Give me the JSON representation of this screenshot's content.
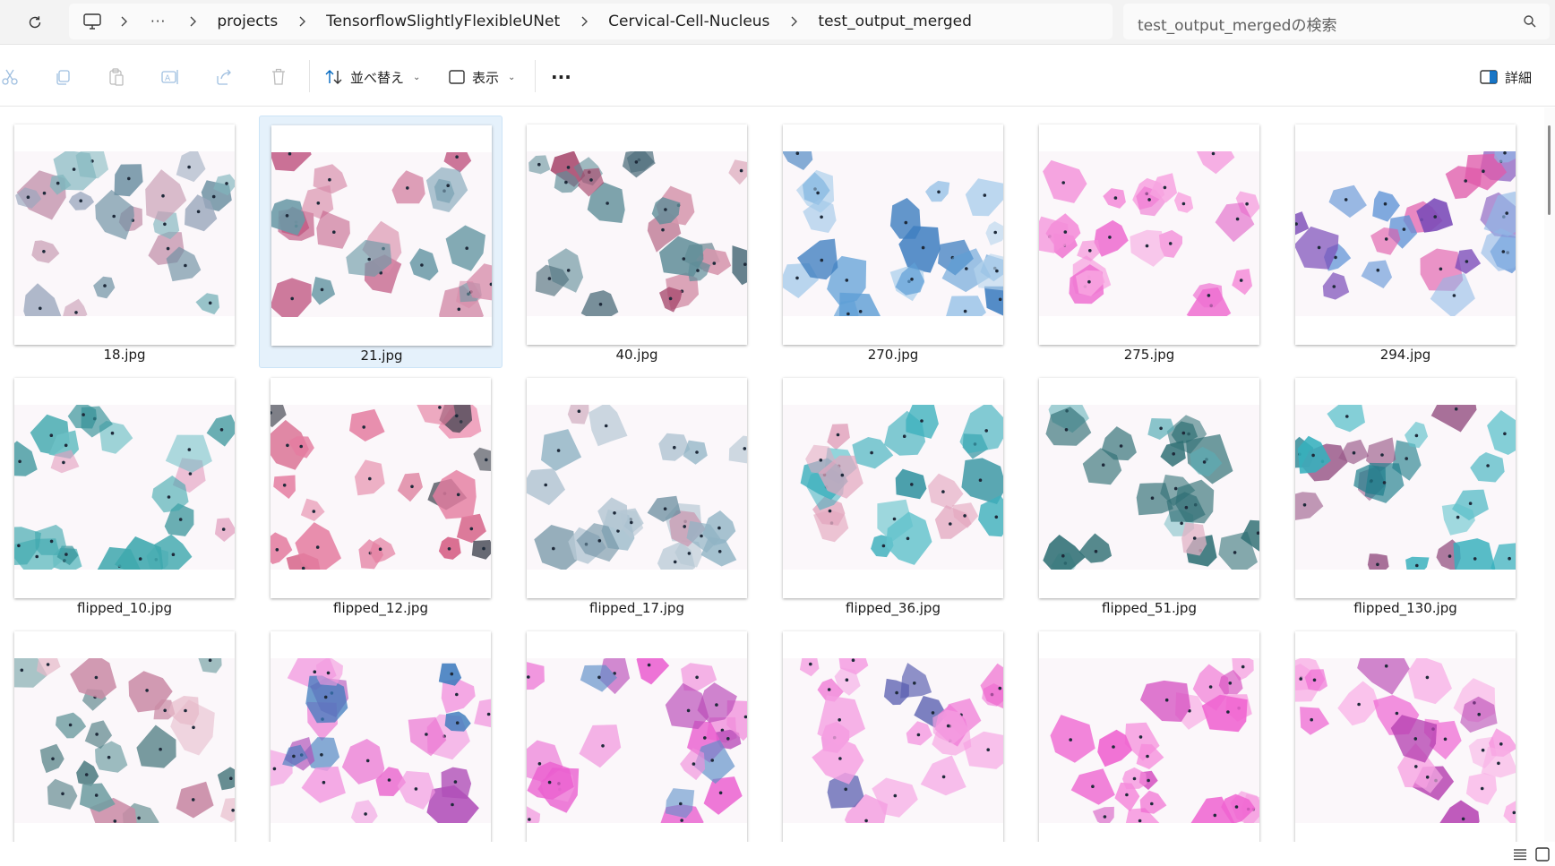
{
  "address": {
    "more": "···",
    "crumbs": [
      "projects",
      "TensorflowSlightlyFlexibleUNet",
      "Cervical-Cell-Nucleus",
      "test_output_merged"
    ],
    "search_placeholder": "test_output_mergedの検索"
  },
  "toolbar": {
    "sort_label": "並べ替え",
    "view_label": "表示",
    "more_label": "···",
    "details_label": "詳細",
    "icons": [
      "cut-icon",
      "copy-icon",
      "paste-icon",
      "rename-icon",
      "share-icon",
      "delete-icon"
    ]
  },
  "files": [
    {
      "name": "18.jpg",
      "selected": false,
      "palette": [
        "#7fb5bd",
        "#c89cb3",
        "#9aa7bd",
        "#6b8fa1"
      ]
    },
    {
      "name": "21.jpg",
      "selected": true,
      "palette": [
        "#c25d86",
        "#6a9aa6",
        "#d68aa8",
        "#7fa5b8"
      ]
    },
    {
      "name": "40.jpg",
      "selected": false,
      "palette": [
        "#a84a6e",
        "#5f8d98",
        "#d698ae",
        "#4f6f7c"
      ]
    },
    {
      "name": "270.jpg",
      "selected": false,
      "palette": [
        "#5f9fd6",
        "#9dc6e8",
        "#3f7fc0",
        "#b7d6ee"
      ]
    },
    {
      "name": "275.jpg",
      "selected": false,
      "palette": [
        "#ee6fd0",
        "#f48ed9",
        "#e05ac4",
        "#f7a3e0"
      ]
    },
    {
      "name": "294.jpg",
      "selected": false,
      "palette": [
        "#5f93d6",
        "#e05aaa",
        "#8fb8e6",
        "#7b4bb8"
      ]
    },
    {
      "name": "flipped_10.jpg",
      "selected": false,
      "palette": [
        "#3fa8ae",
        "#6cc0c4",
        "#e3a0c0",
        "#2f8f95"
      ]
    },
    {
      "name": "flipped_12.jpg",
      "selected": false,
      "palette": [
        "#d2507a",
        "#e47da0",
        "#3a3f4a",
        "#ee9cb8"
      ]
    },
    {
      "name": "flipped_17.jpg",
      "selected": false,
      "palette": [
        "#8fb3c4",
        "#c9a0b6",
        "#6d8fa1",
        "#b6c8d4"
      ]
    },
    {
      "name": "flipped_36.jpg",
      "selected": false,
      "palette": [
        "#3db0bd",
        "#63c3cc",
        "#2a8f9c",
        "#e3a7bf"
      ]
    },
    {
      "name": "flipped_51.jpg",
      "selected": false,
      "palette": [
        "#5aaeb6",
        "#8fc7cd",
        "#2f6f74",
        "#e2b3c5"
      ]
    },
    {
      "name": "flipped_130.jpg",
      "selected": false,
      "palette": [
        "#36b0bd",
        "#5fc3cc",
        "#1f7f8c",
        "#9b5c8a"
      ]
    },
    {
      "name": "",
      "selected": false,
      "palette": [
        "#c98aa5",
        "#6f9ea2",
        "#e6b8c8",
        "#4f7d82"
      ]
    },
    {
      "name": "",
      "selected": false,
      "palette": [
        "#ea6fd0",
        "#3d7bbd",
        "#b04fb8",
        "#f29be0"
      ]
    },
    {
      "name": "",
      "selected": false,
      "palette": [
        "#ea5ccf",
        "#5b8ec8",
        "#f08fdc",
        "#b94bb8"
      ]
    },
    {
      "name": "",
      "selected": false,
      "palette": [
        "#ee5fcc",
        "#f07fd8",
        "#5a5fb0",
        "#f5a0e2"
      ]
    },
    {
      "name": "",
      "selected": false,
      "palette": [
        "#ef63d0",
        "#f58adb",
        "#d44cbf",
        "#f7a8e4"
      ]
    },
    {
      "name": "",
      "selected": false,
      "palette": [
        "#ee66d2",
        "#f58cdc",
        "#b43fb0",
        "#f9b0e6"
      ]
    }
  ],
  "colors": {
    "accent": "#0067c0",
    "selection": "#e5f1fb"
  }
}
